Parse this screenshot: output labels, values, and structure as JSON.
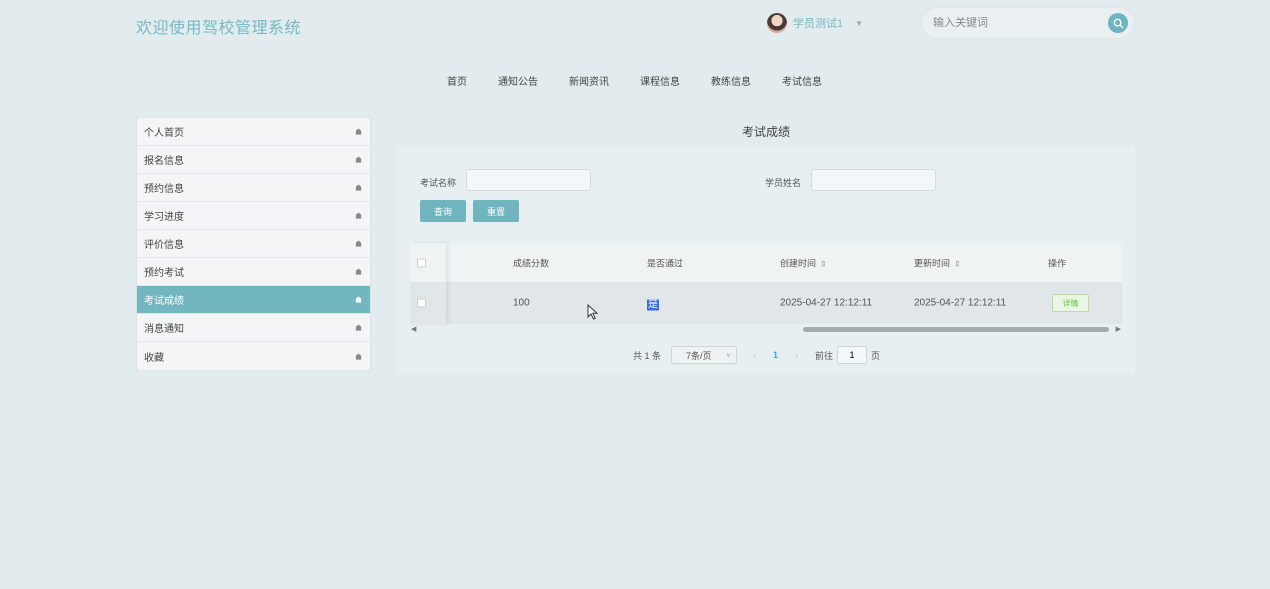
{
  "header": {
    "site_title": "欢迎使用驾校管理系统",
    "user_name": "学员测试1",
    "search_placeholder": "输入关键词"
  },
  "nav": {
    "items": [
      "首页",
      "通知公告",
      "新闻资讯",
      "课程信息",
      "教练信息",
      "考试信息"
    ]
  },
  "sidebar": {
    "items": [
      {
        "label": "个人首页"
      },
      {
        "label": "报名信息"
      },
      {
        "label": "预约信息"
      },
      {
        "label": "学习进度"
      },
      {
        "label": "评价信息"
      },
      {
        "label": "预约考试"
      },
      {
        "label": "考试成绩",
        "active": true
      },
      {
        "label": "消息通知"
      },
      {
        "label": "收藏"
      }
    ]
  },
  "main": {
    "title": "考试成绩",
    "filters": {
      "exam_name_label": "考试名称",
      "exam_name_value": "",
      "student_name_label": "学员姓名",
      "student_name_value": "",
      "query_button": "查询",
      "reset_button": "重置"
    },
    "table": {
      "columns": [
        "成绩分数",
        "是否通过",
        "创建时间",
        "更新时间",
        "操作"
      ],
      "rows": [
        {
          "score": "100",
          "passed": "是",
          "created": "2025-04-27 12:12:11",
          "updated": "2025-04-27 12:12:11",
          "action": "详情"
        }
      ]
    },
    "pagination": {
      "total": "共 1 条",
      "page_size": "7条/页",
      "current_page": "1",
      "goto_label": "前往",
      "goto_value": "1",
      "page_suffix": "页"
    }
  },
  "colors": {
    "accent": "#72b6bf",
    "background": "#e2ebee",
    "link": "#409eff",
    "success": "#67c23a"
  }
}
